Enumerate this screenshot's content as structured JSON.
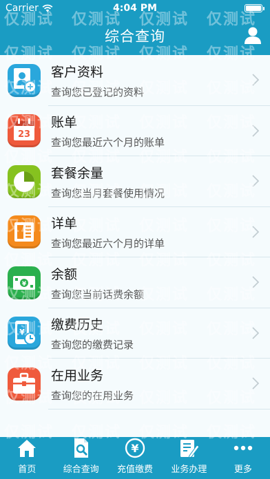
{
  "status_bar": {
    "carrier": "Carrier",
    "time": "4:04 PM",
    "battery_level": 1.0
  },
  "nav": {
    "title": "综合查询",
    "user_icon": "user-icon"
  },
  "items": [
    {
      "title": "客户资料",
      "subtitle": "查询您已登记的资料",
      "icon": "profile-icon",
      "color": "#2aa7dc"
    },
    {
      "title": "账单",
      "subtitle": "查询您最近六个月的账单",
      "icon": "calendar-icon",
      "color": "#ef5a3c",
      "icon_text": "23"
    },
    {
      "title": "套餐余量",
      "subtitle": "查询您当月套餐使用情况",
      "icon": "pie-chart-icon",
      "color": "#86c21f"
    },
    {
      "title": "详单",
      "subtitle": "查询您最近六个月的详单",
      "icon": "document-icon",
      "color": "#f48a1c"
    },
    {
      "title": "余额",
      "subtitle": "查询您当前话费余额",
      "icon": "money-icon",
      "color": "#2bb04e"
    },
    {
      "title": "缴费历史",
      "subtitle": "查询您的缴费记录",
      "icon": "payment-history-icon",
      "color": "#2aa7dc"
    },
    {
      "title": "在用业务",
      "subtitle": "查询您的在用业务",
      "icon": "briefcase-icon",
      "color": "#ef5a3c"
    }
  ],
  "tabs": [
    {
      "label": "首页",
      "icon": "home-icon"
    },
    {
      "label": "综合查询",
      "icon": "query-icon"
    },
    {
      "label": "充值缴费",
      "icon": "yuan-icon"
    },
    {
      "label": "业务办理",
      "icon": "edit-icon"
    },
    {
      "label": "更多",
      "icon": "more-icon"
    }
  ],
  "watermark": "仅测试",
  "colors": {
    "primary": "#1a9cc3",
    "list_bg": "#f5fbfd"
  }
}
